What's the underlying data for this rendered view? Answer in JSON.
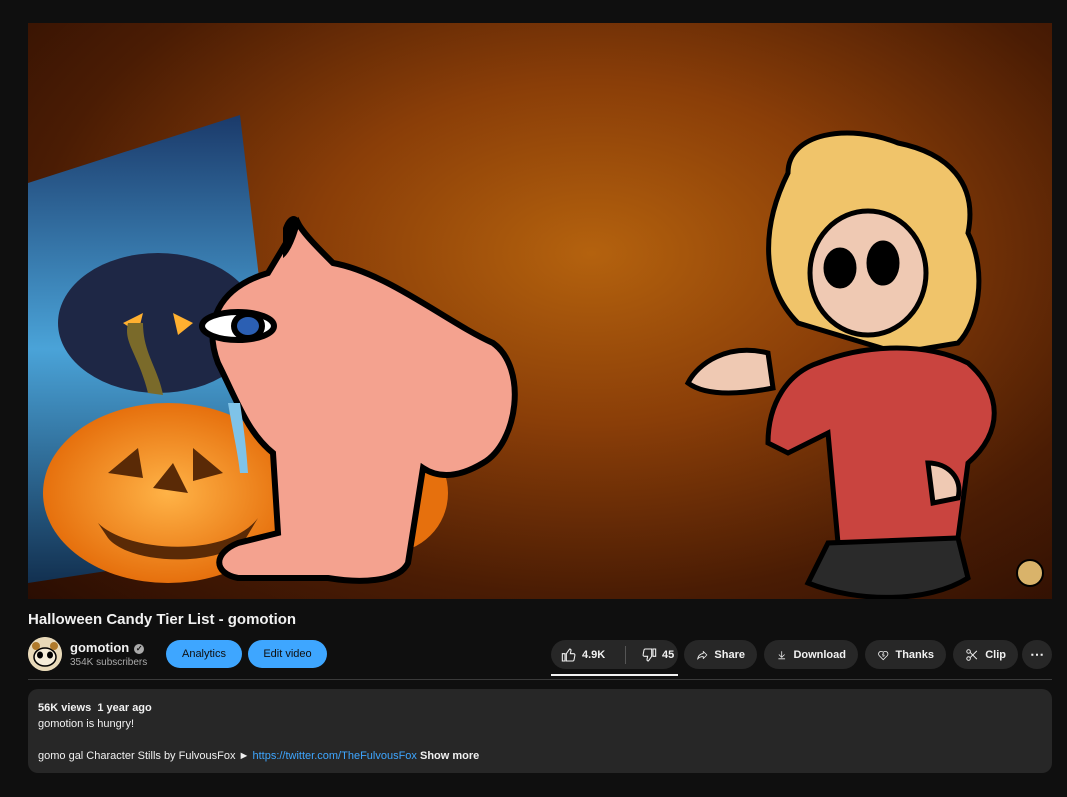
{
  "video": {
    "title": "Halloween Candy Tier List - gomotion"
  },
  "channel": {
    "name": "gomotion",
    "subscribers": "354K subscribers",
    "verified_icon": "check-icon"
  },
  "owner_actions": {
    "analytics_label": "Analytics",
    "edit_label": "Edit video"
  },
  "actions": {
    "likes": "4.9K",
    "dislikes": "45",
    "share_label": "Share",
    "download_label": "Download",
    "thanks_label": "Thanks",
    "clip_label": "Clip",
    "more_label": "⋯"
  },
  "description": {
    "views": "56K views",
    "age": "1 year ago",
    "line1": "gomotion is hungry!",
    "line2_prefix": "gomo gal Character Stills by FulvousFox ► ",
    "link": "https://twitter.com/TheFulvousFox",
    "show_more": "Show more"
  },
  "colors": {
    "background": "#0f0f0f",
    "pill": "#272727",
    "accent": "#3ea6ff"
  }
}
